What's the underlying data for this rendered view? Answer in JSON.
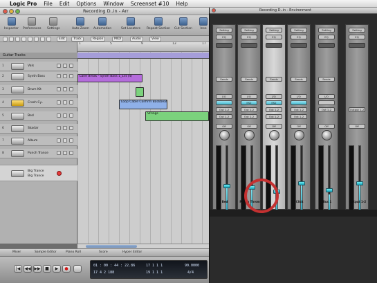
{
  "menubar": {
    "items": [
      "Logic Pro",
      "File",
      "Edit",
      "Options",
      "Window",
      "Screenset #10",
      "Help"
    ]
  },
  "window": {
    "title": "Recording D..in - Arr"
  },
  "toolbar": {
    "buttons": [
      "Inspector",
      "Preferences",
      "Settings",
      "Auto Zoom",
      "Automation",
      "Set Locators",
      "Repeat Section",
      "Cut Section",
      "Inse"
    ]
  },
  "arrange_menu": {
    "items": [
      "Edit",
      "Track",
      "Region",
      "MIDI",
      "Audio",
      "View"
    ]
  },
  "tracks": {
    "folder_label": "Guitar Tracks",
    "list": [
      {
        "num": "1",
        "name": "Vals"
      },
      {
        "num": "2",
        "name": "Synth Bass"
      },
      {
        "num": "3",
        "name": "Drum Kit"
      },
      {
        "num": "4",
        "name": "Crash Cy.."
      },
      {
        "num": "5",
        "name": "Bed"
      },
      {
        "num": "6",
        "name": "Skadar"
      },
      {
        "num": "7",
        "name": "Album"
      },
      {
        "num": "8",
        "name": "Punch Trance"
      }
    ],
    "selected": {
      "line1": "Big Trance",
      "line2": "Big Trance"
    }
  },
  "ruler": {
    "ticks": [
      "1",
      "5",
      "9",
      "13",
      "17"
    ]
  },
  "regions": {
    "synth": "Lane Break - Synth Bass 1_1st (4)",
    "audio": "Loop Cable Confirm Backbeat",
    "small": "Strings"
  },
  "tabs": [
    "Mixer",
    "Sample Editor",
    "Piano Roll",
    "Score",
    "Hyper Editor"
  ],
  "transport": {
    "buttons": [
      "|◀",
      "◀◀",
      "▶▶",
      "■",
      "▶",
      "●"
    ],
    "lcd": {
      "smpte": "01 : 00 : 44 : 22.86",
      "bars": "17   4   2   188",
      "pos1": "17   1   1   1",
      "pos2": "19   1   1   1",
      "tempo": "90.0000",
      "sig": "4/4"
    }
  },
  "mixer": {
    "title": "Recording D..in - Environment",
    "strips": [
      {
        "name": "Bed",
        "setting": "Setting",
        "insert_main": "",
        "selected": false
      },
      {
        "name": "Punch Throw",
        "setting": "Setting",
        "insert_main": "ES2",
        "selected": false
      },
      {
        "name": "",
        "setting": "Setting",
        "insert_main": "ES2",
        "selected": true
      },
      {
        "name": "Click",
        "setting": "Setting",
        "insert_main": "",
        "selected": false
      },
      {
        "name": "Bus 1",
        "setting": "Setting",
        "insert_main": "",
        "selected": false
      },
      {
        "name": "Output 1-2",
        "setting": "Setting",
        "insert_main": "",
        "selected": false
      }
    ],
    "slot_labels": {
      "eq": "EQ",
      "sends": "Sends",
      "io": "I/O",
      "out": "Out 1-2",
      "off": "Off",
      "read": "Read",
      "stereo_out": "Output 1-2"
    }
  },
  "colors": {
    "accent_blue": "#3fb8cf",
    "region_purple": "#a59dd9",
    "region_blue": "#8fb0e8",
    "region_green": "#7bd27d",
    "record_red": "#e83a3a"
  }
}
